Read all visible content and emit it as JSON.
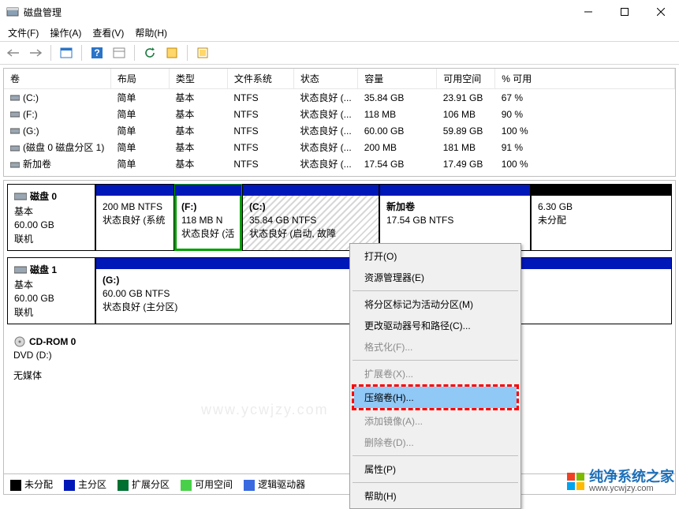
{
  "window": {
    "title": "磁盘管理",
    "controls": {
      "min": "—",
      "max": "□",
      "close": "×"
    }
  },
  "menu": {
    "file": "文件(F)",
    "action": "操作(A)",
    "view": "查看(V)",
    "help": "帮助(H)"
  },
  "table": {
    "headers": {
      "volume": "卷",
      "layout": "布局",
      "type": "类型",
      "fs": "文件系统",
      "status": "状态",
      "capacity": "容量",
      "free": "可用空间",
      "pctfree": "% 可用"
    },
    "rows": [
      {
        "vol": "(C:)",
        "layout": "简单",
        "type": "基本",
        "fs": "NTFS",
        "status": "状态良好 (...",
        "capacity": "35.84 GB",
        "free": "23.91 GB",
        "pct": "67 %"
      },
      {
        "vol": "(F:)",
        "layout": "简单",
        "type": "基本",
        "fs": "NTFS",
        "status": "状态良好 (...",
        "capacity": "118 MB",
        "free": "106 MB",
        "pct": "90 %"
      },
      {
        "vol": "(G:)",
        "layout": "简单",
        "type": "基本",
        "fs": "NTFS",
        "status": "状态良好 (...",
        "capacity": "60.00 GB",
        "free": "59.89 GB",
        "pct": "100 %"
      },
      {
        "vol": "(磁盘 0 磁盘分区 1)",
        "layout": "简单",
        "type": "基本",
        "fs": "NTFS",
        "status": "状态良好 (...",
        "capacity": "200 MB",
        "free": "181 MB",
        "pct": "91 %"
      },
      {
        "vol": "新加卷",
        "layout": "简单",
        "type": "基本",
        "fs": "NTFS",
        "status": "状态良好 (...",
        "capacity": "17.54 GB",
        "free": "17.49 GB",
        "pct": "100 %"
      }
    ]
  },
  "disks": {
    "d0": {
      "name": "磁盘 0",
      "type": "基本",
      "size": "60.00 GB",
      "status": "联机"
    },
    "d0p1": {
      "line1": "200 MB NTFS",
      "line2": "状态良好 (系统"
    },
    "d0p2": {
      "name": "(F:)",
      "line1": "118 MB N",
      "line2": "状态良好 (活"
    },
    "d0p3": {
      "name": "(C:)",
      "line1": "35.84 GB NTFS",
      "line2": "状态良好 (启动, 故障"
    },
    "d0p4": {
      "name": "新加卷",
      "line1": "17.54 GB NTFS",
      "line2": ""
    },
    "d0p5": {
      "line1": "6.30 GB",
      "line2": "未分配"
    },
    "d1": {
      "name": "磁盘 1",
      "type": "基本",
      "size": "60.00 GB",
      "status": "联机"
    },
    "d1p1": {
      "name": "(G:)",
      "line1": "60.00 GB NTFS",
      "line2": "状态良好 (主分区)"
    },
    "cd": {
      "name": "CD-ROM 0",
      "sub": "DVD (D:)",
      "status": "无媒体"
    }
  },
  "legend": {
    "unalloc": "未分配",
    "primary": "主分区",
    "extended": "扩展分区",
    "free": "可用空间",
    "logical": "逻辑驱动器"
  },
  "context": {
    "open": "打开(O)",
    "explorer": "资源管理器(E)",
    "active": "将分区标记为活动分区(M)",
    "change": "更改驱动器号和路径(C)...",
    "format": "格式化(F)...",
    "extend": "扩展卷(X)...",
    "shrink": "压缩卷(H)...",
    "mirror": "添加镜像(A)...",
    "delete": "删除卷(D)...",
    "prop": "属性(P)",
    "help": "帮助(H)"
  },
  "watermark": {
    "main": "纯净系统之家",
    "sub": "www.ycwjzy.com",
    "faint": "www.ycwjzy.com"
  }
}
